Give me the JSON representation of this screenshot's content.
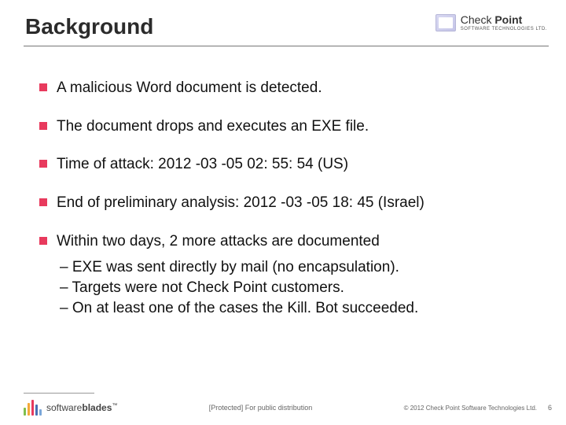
{
  "header": {
    "title": "Background",
    "logo": {
      "line1_prefix": "Check ",
      "line1_bold": "Point",
      "line2": "SOFTWARE TECHNOLOGIES LTD."
    }
  },
  "bullets": [
    {
      "text": "A malicious Word document is detected."
    },
    {
      "text": "The document drops and executes an EXE file."
    },
    {
      "text": "Time of attack: 2012 -03 -05 02: 55: 54 (US)"
    },
    {
      "text": "End of preliminary analysis: 2012 -03 -05 18: 45 (Israel)"
    },
    {
      "text": "Within two days, 2 more attacks are documented",
      "subs": [
        "– EXE was sent directly by mail (no encapsulation).",
        "– Targets were not Check Point customers.",
        "– On at least one of the cases the Kill. Bot succeeded."
      ]
    }
  ],
  "footer": {
    "brand_thin": "software",
    "brand_bold": "blades",
    "tm": "™",
    "center": "[Protected] For public distribution",
    "copyright": "© 2012 Check Point Software Technologies Ltd.",
    "page": "6"
  }
}
